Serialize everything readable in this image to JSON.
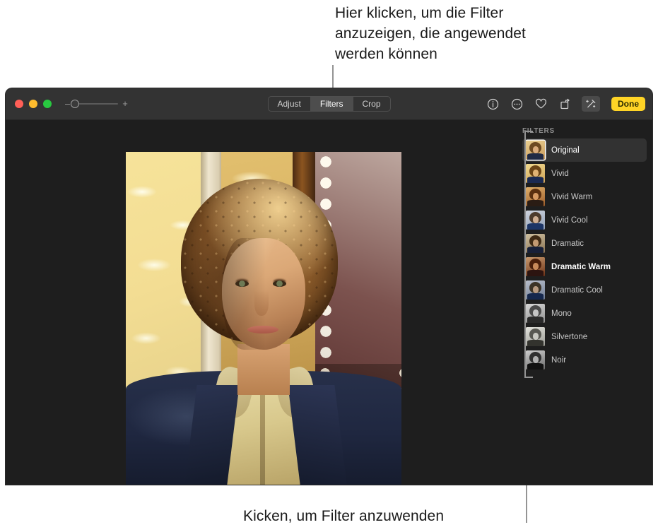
{
  "annotations": {
    "top_callout": "Hier klicken, um die Filter\nanzuzeigen, die angewendet\nwerden können",
    "bottom_callout": "Kicken, um Filter anzuwenden"
  },
  "window": {
    "traffic_lights": [
      "close",
      "minimize",
      "zoom"
    ],
    "zoom_control": {
      "minus_label": "–",
      "plus_label": "+",
      "value": 0
    },
    "segmented_control": {
      "options": [
        "Adjust",
        "Filters",
        "Crop"
      ],
      "selected": "Filters"
    },
    "toolbar_icons": [
      {
        "name": "info-icon",
        "glyph": "info"
      },
      {
        "name": "more-options-icon",
        "glyph": "ellipsis"
      },
      {
        "name": "favorite-heart-icon",
        "glyph": "heart"
      },
      {
        "name": "rotate-icon",
        "glyph": "rotate"
      },
      {
        "name": "auto-enhance-icon",
        "glyph": "wand",
        "active": true
      }
    ],
    "done_label": "Done"
  },
  "sidebar": {
    "header": "FILTERS",
    "filters": [
      {
        "label": "Original",
        "selected": true,
        "active": false
      },
      {
        "label": "Vivid",
        "selected": false,
        "active": false
      },
      {
        "label": "Vivid Warm",
        "selected": false,
        "active": false
      },
      {
        "label": "Vivid Cool",
        "selected": false,
        "active": false
      },
      {
        "label": "Dramatic",
        "selected": false,
        "active": false
      },
      {
        "label": "Dramatic Warm",
        "selected": false,
        "active": true
      },
      {
        "label": "Dramatic Cool",
        "selected": false,
        "active": false
      },
      {
        "label": "Mono",
        "selected": false,
        "active": false
      },
      {
        "label": "Silvertone",
        "selected": false,
        "active": false
      },
      {
        "label": "Noir",
        "selected": false,
        "active": false
      }
    ]
  },
  "photo": {
    "description": "Portrait of a young man with curly hair in a navy jacket, warm sunlight"
  },
  "colors": {
    "accent_done": "#ffd426",
    "toolbar_bg": "#333333",
    "window_bg": "#1e1e1e",
    "selected_row_bg": "#323232",
    "callout_line": "#949494"
  }
}
